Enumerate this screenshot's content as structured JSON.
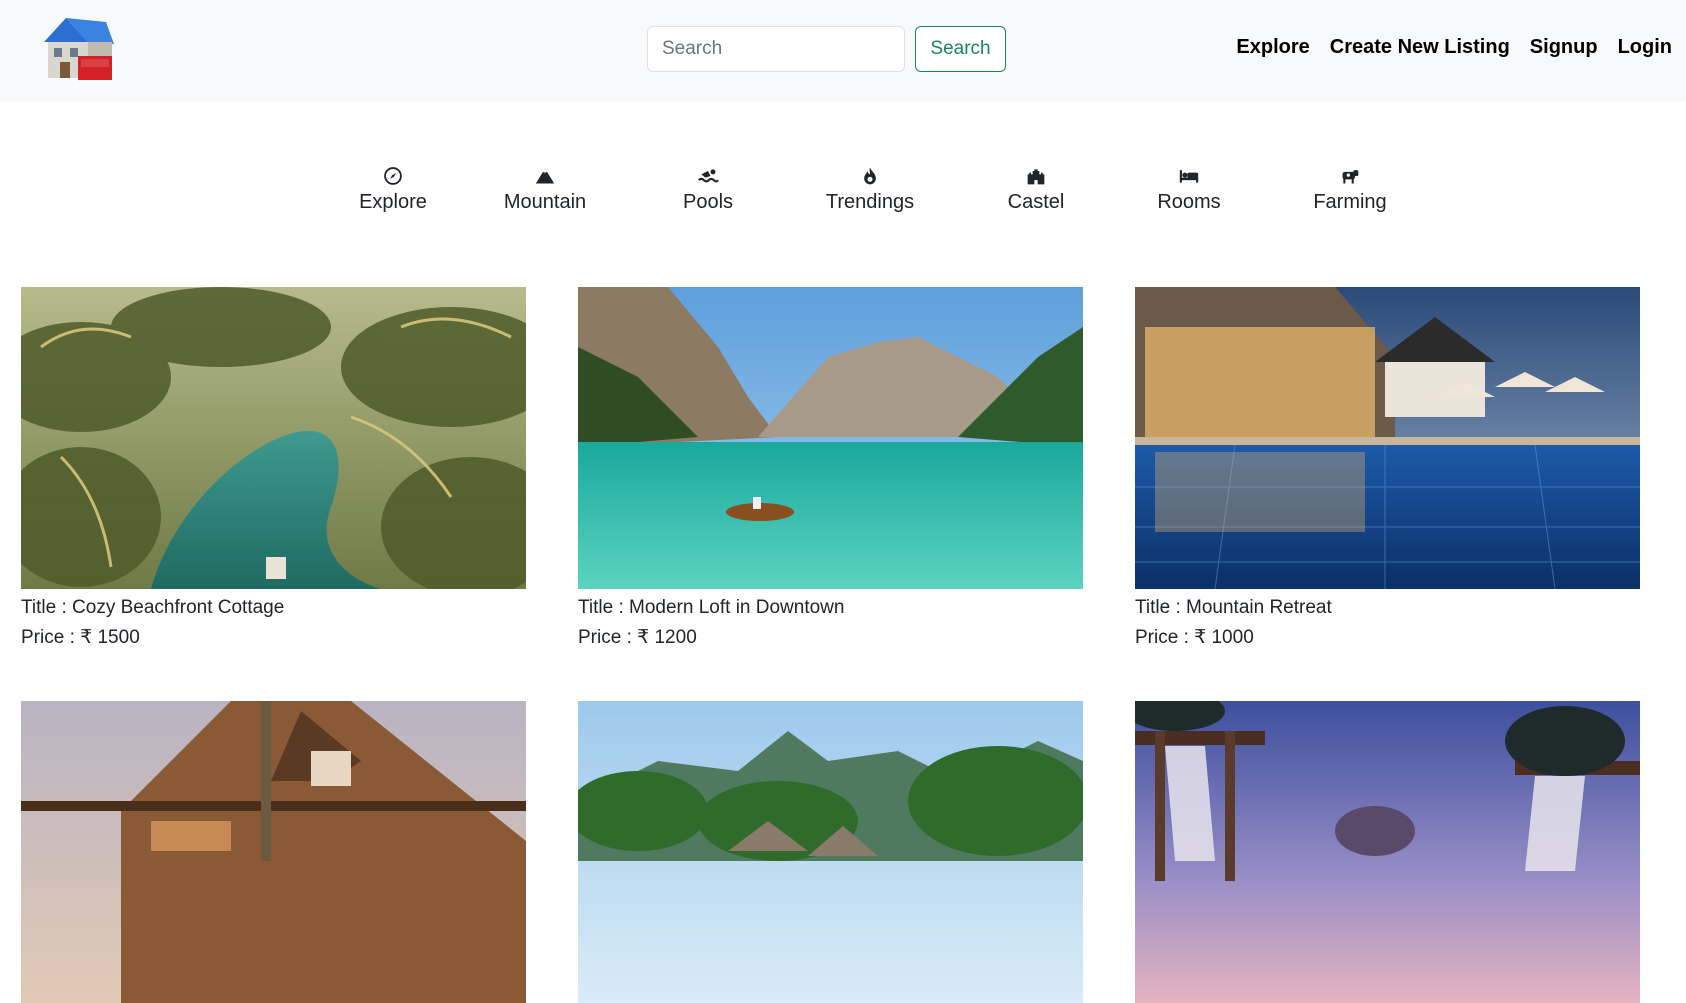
{
  "nav": {
    "search_placeholder": "Search",
    "search_button": "Search",
    "links": [
      "Explore",
      "Create New Listing",
      "Signup",
      "Login"
    ]
  },
  "filters": [
    {
      "label": "Explore",
      "icon": "compass-icon"
    },
    {
      "label": "Mountain",
      "icon": "mountain-icon"
    },
    {
      "label": "Pools",
      "icon": "swimmer-icon"
    },
    {
      "label": "Trendings",
      "icon": "fire-icon"
    },
    {
      "label": "Castel",
      "icon": "castle-icon"
    },
    {
      "label": "Rooms",
      "icon": "bed-icon"
    },
    {
      "label": "Farming",
      "icon": "cow-icon"
    }
  ],
  "listings": [
    {
      "title": "Title : Cozy Beachfront Cottage",
      "price": "Price : ₹ 1500"
    },
    {
      "title": "Title : Modern Loft in Downtown",
      "price": "Price : ₹ 1200"
    },
    {
      "title": "Title : Mountain Retreat",
      "price": "Price : ₹ 1000"
    },
    {
      "title": "",
      "price": ""
    },
    {
      "title": "",
      "price": ""
    },
    {
      "title": "",
      "price": ""
    }
  ],
  "colors": {
    "navbar_bg": "#f8f9fa",
    "search_button": "#198754",
    "text": "#212529"
  }
}
